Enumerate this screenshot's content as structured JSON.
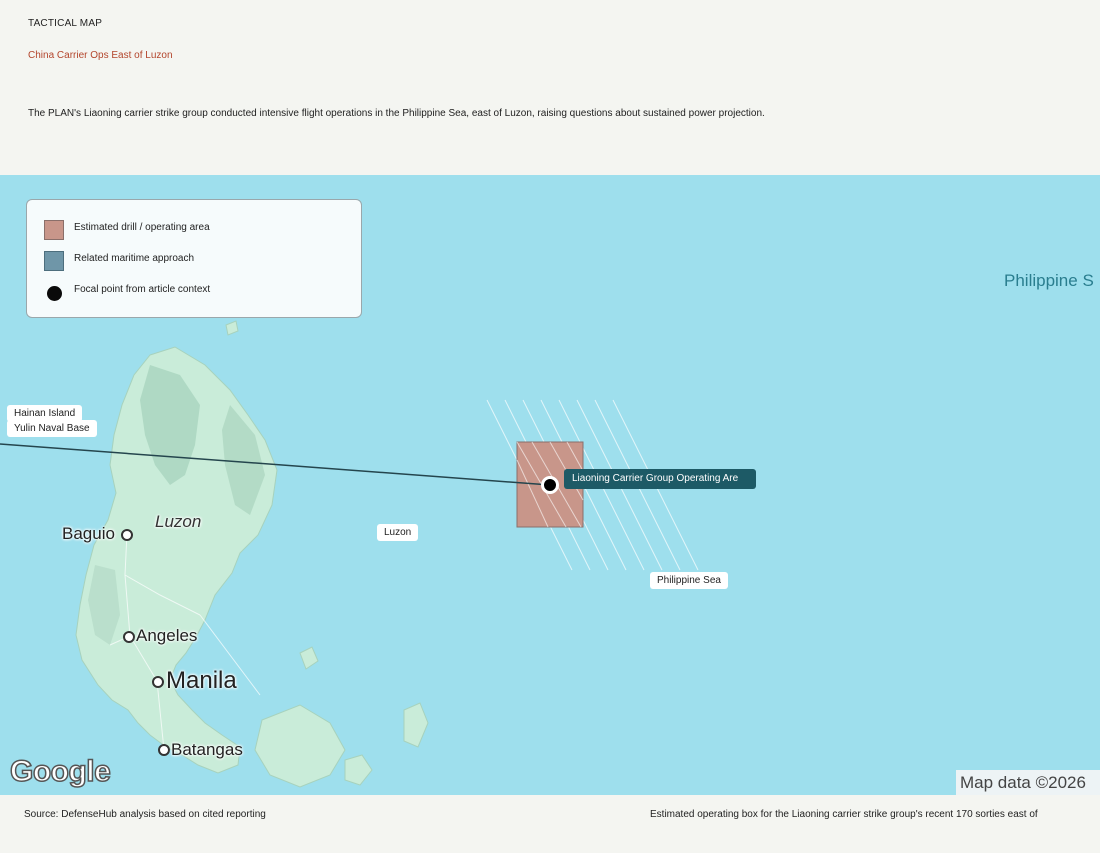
{
  "header": {
    "kicker": "TACTICAL MAP",
    "title": "China Carrier Ops East of Luzon",
    "description": "The PLAN's Liaoning carrier strike group conducted intensive flight operations in the Philippine Sea, east of Luzon, raising questions about sustained power projection."
  },
  "legend": {
    "items": [
      {
        "label": "Estimated drill / operating area",
        "color": "#c8968a"
      },
      {
        "label": "Related maritime approach",
        "color": "#6f96a8"
      },
      {
        "label": "Focal point from article context",
        "color": "#0a0a0a"
      }
    ]
  },
  "map": {
    "labels": {
      "hainan": "Hainan Island",
      "yulin": "Yulin Naval Base",
      "luzon_pill": "Luzon",
      "philippine_sea_pill": "Philippine Sea",
      "operating_area": "Liaoning Carrier Group Operating Are"
    },
    "places": {
      "baguio": "Baguio",
      "luzon": "Luzon",
      "angeles": "Angeles",
      "manila": "Manila",
      "batangas": "Batangas",
      "philippine_sea": "Philippine S"
    },
    "google_logo": "Google",
    "attribution": "Map data ©2026"
  },
  "footer": {
    "source": "Source: DefenseHub analysis based on cited reporting",
    "caption": "Estimated operating box for the Liaoning carrier strike group's recent 170 sorties east of"
  }
}
